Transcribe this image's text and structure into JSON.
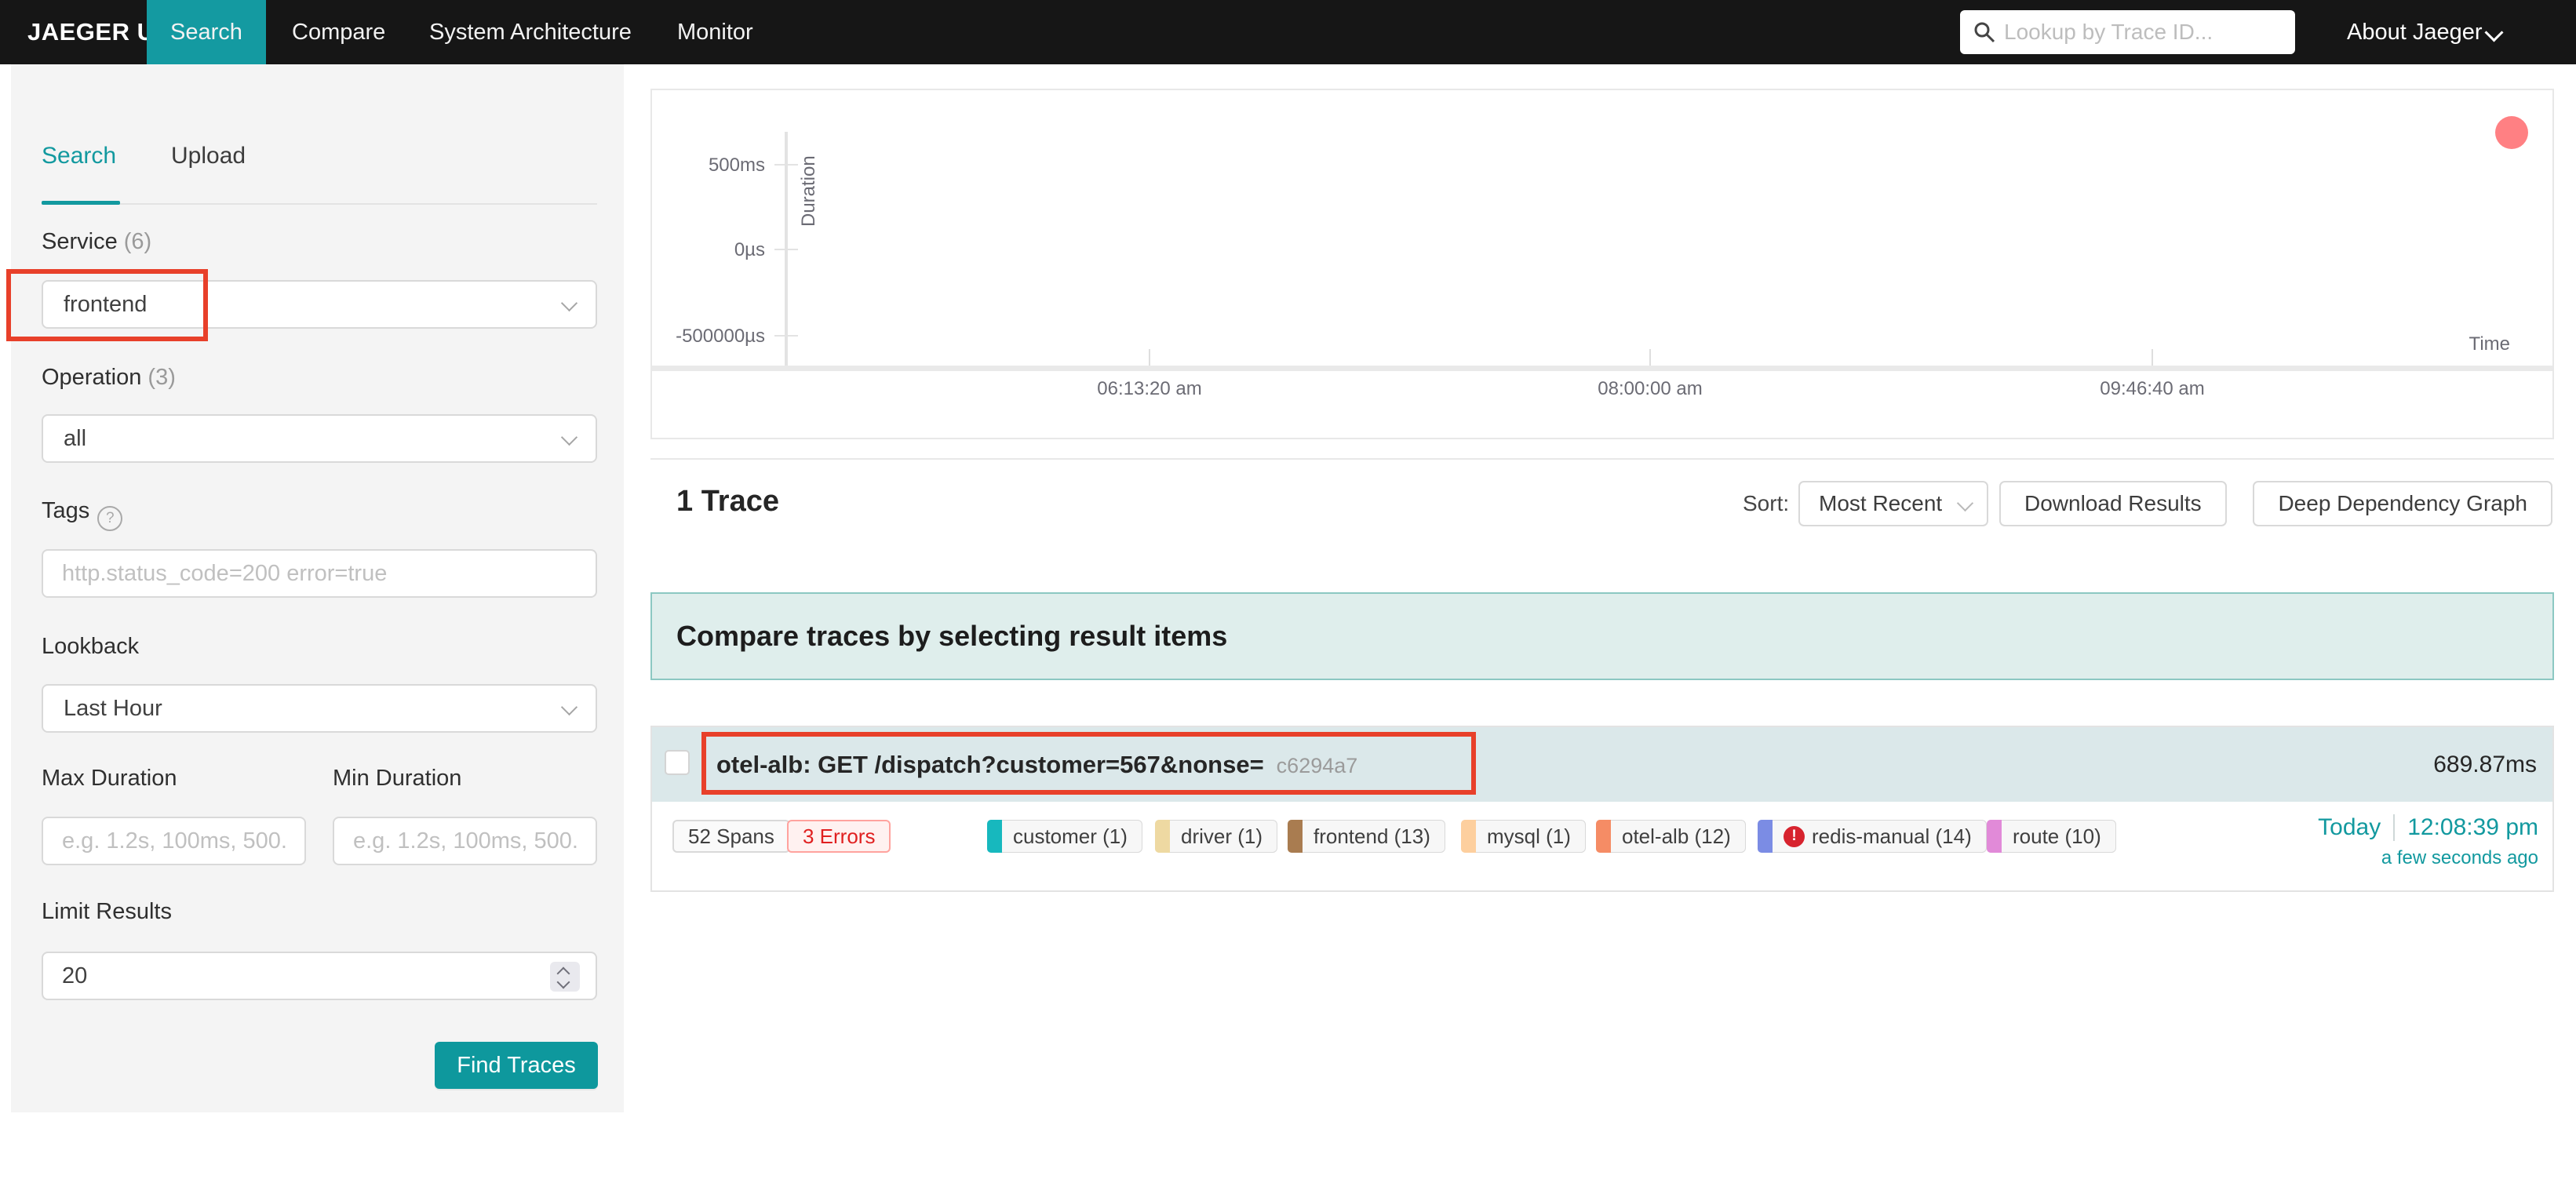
{
  "navbar": {
    "brand": "JAEGER UI",
    "items": [
      {
        "label": "Search"
      },
      {
        "label": "Compare"
      },
      {
        "label": "System Architecture"
      },
      {
        "label": "Monitor"
      }
    ],
    "trace_lookup_placeholder": "Lookup by Trace ID...",
    "about_label": "About Jaeger"
  },
  "sidebar": {
    "tabs": [
      {
        "label": "Search"
      },
      {
        "label": "Upload"
      }
    ],
    "service": {
      "label": "Service",
      "count": "(6)",
      "value": "frontend"
    },
    "operation": {
      "label": "Operation",
      "count": "(3)",
      "value": "all"
    },
    "tags": {
      "label": "Tags",
      "help_icon": "?",
      "placeholder": "http.status_code=200 error=true"
    },
    "lookback": {
      "label": "Lookback",
      "value": "Last Hour"
    },
    "max_duration": {
      "label": "Max Duration",
      "placeholder": "e.g. 1.2s, 100ms, 500..."
    },
    "min_duration": {
      "label": "Min Duration",
      "placeholder": "e.g. 1.2s, 100ms, 500..."
    },
    "limit": {
      "label": "Limit Results",
      "value": "20"
    },
    "find_button": "Find Traces"
  },
  "chart_data": {
    "type": "scatter",
    "xlabel": "Time",
    "ylabel": "Duration",
    "x_ticks": [
      "06:13:20 am",
      "08:00:00 am",
      "09:46:40 am"
    ],
    "y_ticks": [
      "500ms",
      "0µs",
      "-500000µs"
    ],
    "ylim_labels": [
      "-500000µs",
      "500ms"
    ],
    "grid": false,
    "points": [
      {
        "time": "12:08:39 pm",
        "duration": "689.87ms",
        "color": "#ff8083"
      }
    ]
  },
  "results": {
    "count_label": "1 Trace",
    "sort_label": "Sort:",
    "sort_value": "Most Recent",
    "download_button": "Download Results",
    "ddg_button": "Deep Dependency Graph",
    "compare_banner": "Compare traces by selecting result items"
  },
  "trace": {
    "title": "otel-alb: GET /dispatch?customer=567&nonse=",
    "trace_id": "c6294a7",
    "duration": "689.87ms",
    "spans_badge": "52 Spans",
    "errors_badge": "3 Errors",
    "error_icon": "!",
    "services": [
      {
        "name": "customer (1)",
        "color": "#17b8be"
      },
      {
        "name": "driver (1)",
        "color": "#eed9a2"
      },
      {
        "name": "frontend (13)",
        "color": "#a97c50"
      },
      {
        "name": "mysql (1)",
        "color": "#fdcf9e"
      },
      {
        "name": "otel-alb (12)",
        "color": "#f58c65"
      },
      {
        "name": "redis-manual (14)",
        "color": "#7b8ce4"
      },
      {
        "name": "route (10)",
        "color": "#e18ad8"
      }
    ],
    "date": "Today",
    "time": "12:08:39 pm",
    "relative_time": "a few seconds ago"
  },
  "annotations": {
    "color": "#e8402a"
  }
}
